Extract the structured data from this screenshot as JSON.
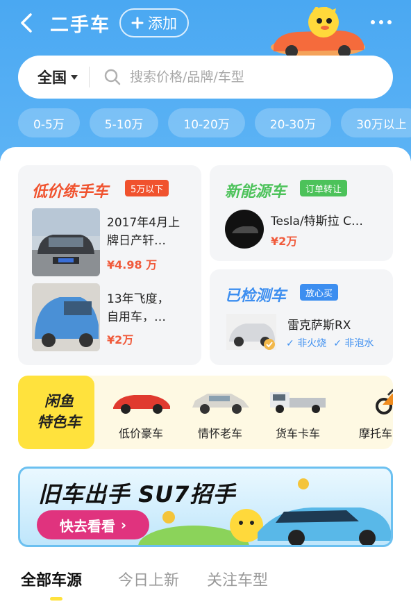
{
  "header": {
    "title": "二手车",
    "add_label": "添加"
  },
  "search": {
    "region": "全国",
    "placeholder": "搜索价格/品牌/车型"
  },
  "price_chips": [
    "0-5万",
    "5-10万",
    "10-20万",
    "20-30万",
    "30万以上"
  ],
  "cheap_cars": {
    "title": "低价练手车",
    "tag": "5万以下",
    "items": [
      {
        "title_line1": "2017年4月上",
        "title_line2": "牌日产轩…",
        "price": "¥4.98 万"
      },
      {
        "title_line1": "13年飞度，",
        "title_line2": "自用车，…",
        "price": "¥2万"
      }
    ]
  },
  "new_energy": {
    "title": "新能源车",
    "tag": "订单转让",
    "item": {
      "title": "Tesla/特斯拉 C…",
      "price": "¥2万"
    }
  },
  "inspected": {
    "title": "已检测车",
    "tag": "放心买",
    "item": {
      "title": "雷克萨斯RX",
      "badge1": "非火烧",
      "badge2": "非泡水"
    }
  },
  "features": {
    "logo_line1": "闲鱼",
    "logo_line2": "特色车",
    "items": [
      {
        "label": "低价豪车"
      },
      {
        "label": "情怀老车"
      },
      {
        "label": "货车卡车"
      },
      {
        "label": "摩托车"
      }
    ]
  },
  "banner": {
    "headline": "旧车出手 SU7招手",
    "cta": "快去看看"
  },
  "tabs": [
    {
      "label": "全部车源",
      "active": true
    },
    {
      "label": "今日上新",
      "active": false
    },
    {
      "label": "关注车型",
      "active": false
    }
  ],
  "colors": {
    "header_bg": "#4aa8f2",
    "price": "#f05a3b",
    "cheap_title": "#f0522e",
    "new_energy_title": "#4cc25a",
    "inspected_title": "#3c8ef0",
    "accent_yellow": "#ffe23d",
    "banner_cta": "#e0337e"
  }
}
